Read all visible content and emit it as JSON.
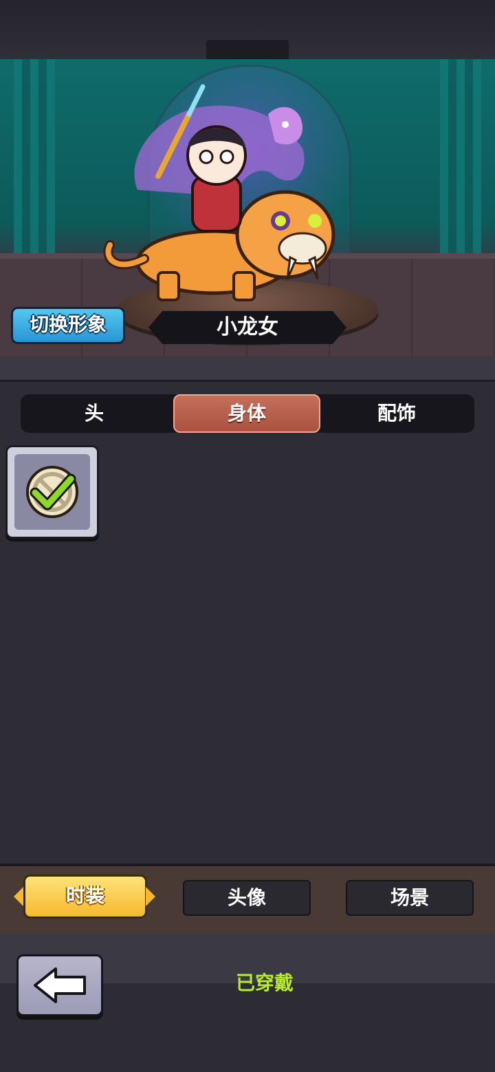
{
  "preview": {
    "switch_label": "切换形象",
    "character_name": "小龙女"
  },
  "category_tabs": [
    {
      "label": "头",
      "active": false
    },
    {
      "label": "身体",
      "active": true
    },
    {
      "label": "配饰",
      "active": false
    }
  ],
  "items": [
    {
      "icon": "check-none-icon",
      "selected": true
    }
  ],
  "bottom_tabs": [
    {
      "label": "时装",
      "active": true
    },
    {
      "label": "头像",
      "active": false
    },
    {
      "label": "场景",
      "active": false
    }
  ],
  "footer": {
    "back_icon": "back-arrow-icon",
    "status": "已穿戴"
  },
  "colors": {
    "accent_orange": "#b85c48",
    "accent_yellow": "#f6b92d",
    "status_green": "#b8e83a",
    "switch_blue": "#2896d5"
  }
}
